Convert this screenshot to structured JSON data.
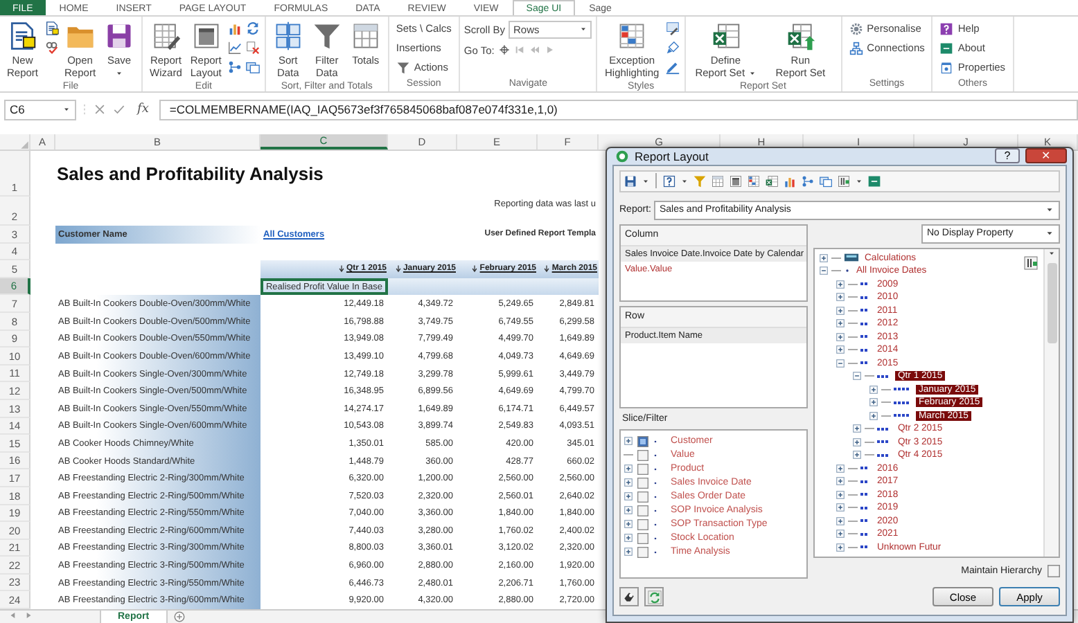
{
  "ribbon": {
    "tabs": [
      {
        "label": "FILE",
        "kind": "file",
        "selected": false
      },
      {
        "label": "HOME",
        "kind": "tab",
        "selected": false
      },
      {
        "label": "INSERT",
        "kind": "tab",
        "selected": false
      },
      {
        "label": "PAGE LAYOUT",
        "kind": "tab",
        "selected": false
      },
      {
        "label": "FORMULAS",
        "kind": "tab",
        "selected": false
      },
      {
        "label": "DATA",
        "kind": "tab",
        "selected": false
      },
      {
        "label": "REVIEW",
        "kind": "tab",
        "selected": false
      },
      {
        "label": "VIEW",
        "kind": "tab",
        "selected": false
      },
      {
        "label": "Sage UI",
        "kind": "tab",
        "selected": true
      },
      {
        "label": "Sage",
        "kind": "tab",
        "selected": false
      }
    ],
    "groups": [
      {
        "label": "File",
        "items": [
          {
            "kind": "large",
            "label": "New Report",
            "menu": false
          },
          {
            "kind": "large",
            "label": "Open Report",
            "menu": false
          },
          {
            "kind": "large",
            "label": "Save",
            "menu": true
          }
        ]
      },
      {
        "label": "Edit",
        "items": [
          {
            "kind": "large",
            "label": "Report Wizard",
            "menu": false
          },
          {
            "kind": "large",
            "label": "Report Layout",
            "menu": false
          }
        ]
      },
      {
        "label": "Sort, Filter and Totals",
        "items": [
          {
            "kind": "large",
            "label": "Sort Data",
            "menu": false
          },
          {
            "kind": "large",
            "label": "Filter Data",
            "menu": false
          },
          {
            "kind": "large",
            "label": "Totals",
            "menu": false
          }
        ]
      },
      {
        "label": "Session",
        "items": [
          {
            "kind": "small",
            "label": "Sets \\ Calcs"
          },
          {
            "kind": "small",
            "label": "Insertions"
          },
          {
            "kind": "small",
            "label": "Actions"
          }
        ]
      },
      {
        "label": "Navigate",
        "items": [
          {
            "kind": "select",
            "label": "Scroll By",
            "value": "Rows"
          },
          {
            "kind": "goto",
            "label": "Go To:"
          }
        ]
      },
      {
        "label": "Styles",
        "items": [
          {
            "kind": "large",
            "label": "Exception Highlighting",
            "menu": false
          }
        ]
      },
      {
        "label": "Report Set",
        "items": [
          {
            "kind": "large",
            "label": "Define Report Set",
            "menu": true
          },
          {
            "kind": "large",
            "label": "Run Report Set",
            "menu": false
          }
        ]
      },
      {
        "label": "Settings",
        "items": [
          {
            "kind": "small",
            "label": "Personalise"
          },
          {
            "kind": "small",
            "label": "Connections"
          }
        ]
      },
      {
        "label": "Others",
        "items": [
          {
            "kind": "small",
            "label": "Help"
          },
          {
            "kind": "small",
            "label": "About"
          },
          {
            "kind": "small",
            "label": "Properties"
          }
        ]
      }
    ]
  },
  "formula_bar": {
    "name_box": "C6",
    "function_label": "fx",
    "formula": "=COLMEMBERNAME(IAQ_IAQ5673ef3f765845068baf087e074f331e,1,0)"
  },
  "sheet": {
    "columns": [
      {
        "label": "A",
        "selected": false
      },
      {
        "label": "B",
        "selected": false
      },
      {
        "label": "C",
        "selected": true
      },
      {
        "label": "D",
        "selected": false
      },
      {
        "label": "E",
        "selected": false
      },
      {
        "label": "F",
        "selected": false
      },
      {
        "label": "G",
        "selected": false
      },
      {
        "label": "H",
        "selected": false
      },
      {
        "label": "I",
        "selected": false
      },
      {
        "label": "J",
        "selected": false
      },
      {
        "label": "K",
        "selected": false
      }
    ],
    "row_numbers": [
      {
        "label": "1",
        "selected": false
      },
      {
        "label": "2",
        "selected": false
      },
      {
        "label": "3",
        "selected": false
      },
      {
        "label": "4",
        "selected": false
      },
      {
        "label": "5",
        "selected": false
      },
      {
        "label": "6",
        "selected": true
      },
      {
        "label": "7",
        "selected": false
      },
      {
        "label": "8",
        "selected": false
      },
      {
        "label": "9",
        "selected": false
      },
      {
        "label": "10",
        "selected": false
      },
      {
        "label": "11",
        "selected": false
      },
      {
        "label": "12",
        "selected": false
      },
      {
        "label": "13",
        "selected": false
      },
      {
        "label": "14",
        "selected": false
      },
      {
        "label": "15",
        "selected": false
      },
      {
        "label": "16",
        "selected": false
      },
      {
        "label": "17",
        "selected": false
      },
      {
        "label": "18",
        "selected": false
      },
      {
        "label": "19",
        "selected": false
      },
      {
        "label": "20",
        "selected": false
      },
      {
        "label": "21",
        "selected": false
      },
      {
        "label": "22",
        "selected": false
      },
      {
        "label": "23",
        "selected": false
      },
      {
        "label": "24",
        "selected": false
      }
    ],
    "title": "Sales and Profitability Analysis",
    "notes": [
      "Reporting data was last u",
      "User Defined Report Templa"
    ],
    "filter": {
      "label": "Customer Name",
      "value": "All Customers"
    },
    "column_headers": [
      "Qtr 1 2015",
      "January 2015",
      "February 2015",
      "March 2015"
    ],
    "measure": {
      "label": "Realised Profit Value In Base",
      "selected": true
    },
    "data_rows": [
      {
        "label": "AB Built-In Cookers Double-Oven/300mm/White",
        "values": [
          "12,449.18",
          "4,349.72",
          "5,249.65",
          "2,849.81"
        ]
      },
      {
        "label": "AB Built-In Cookers Double-Oven/500mm/White",
        "values": [
          "16,798.88",
          "3,749.75",
          "6,749.55",
          "6,299.58"
        ]
      },
      {
        "label": "AB Built-In Cookers Double-Oven/550mm/White",
        "values": [
          "13,949.08",
          "7,799.49",
          "4,499.70",
          "1,649.89"
        ]
      },
      {
        "label": "AB Built-In Cookers Double-Oven/600mm/White",
        "values": [
          "13,499.10",
          "4,799.68",
          "4,049.73",
          "4,649.69"
        ]
      },
      {
        "label": "AB Built-In Cookers Single-Oven/300mm/White",
        "values": [
          "12,749.18",
          "3,299.78",
          "5,999.61",
          "3,449.79"
        ]
      },
      {
        "label": "AB Built-In Cookers Single-Oven/500mm/White",
        "values": [
          "16,348.95",
          "6,899.56",
          "4,649.69",
          "4,799.70"
        ]
      },
      {
        "label": "AB Built-In Cookers Single-Oven/550mm/White",
        "values": [
          "14,274.17",
          "1,649.89",
          "6,174.71",
          "6,449.57"
        ]
      },
      {
        "label": "AB Built-In Cookers Single-Oven/600mm/White",
        "values": [
          "10,543.08",
          "3,899.74",
          "2,549.83",
          "4,093.51"
        ]
      },
      {
        "label": "AB Cooker Hoods Chimney/White",
        "values": [
          "1,350.01",
          "585.00",
          "420.00",
          "345.01"
        ]
      },
      {
        "label": "AB Cooker Hoods Standard/White",
        "values": [
          "1,448.79",
          "360.00",
          "428.77",
          "660.02"
        ]
      },
      {
        "label": "AB Freestanding Electric 2-Ring/300mm/White",
        "values": [
          "6,320.00",
          "1,200.00",
          "2,560.00",
          "2,560.00"
        ]
      },
      {
        "label": "AB Freestanding Electric 2-Ring/500mm/White",
        "values": [
          "7,520.03",
          "2,320.00",
          "2,560.01",
          "2,640.02"
        ]
      },
      {
        "label": "AB Freestanding Electric 2-Ring/550mm/White",
        "values": [
          "7,040.00",
          "3,360.00",
          "1,840.00",
          "1,840.00"
        ]
      },
      {
        "label": "AB Freestanding Electric 2-Ring/600mm/White",
        "values": [
          "7,440.03",
          "3,280.00",
          "1,760.02",
          "2,400.02"
        ]
      },
      {
        "label": "AB Freestanding Electric 3-Ring/300mm/White",
        "values": [
          "8,800.03",
          "3,360.01",
          "3,120.02",
          "2,320.00"
        ]
      },
      {
        "label": "AB Freestanding Electric 3-Ring/500mm/White",
        "values": [
          "6,960.00",
          "2,880.00",
          "2,160.00",
          "1,920.00"
        ]
      },
      {
        "label": "AB Freestanding Electric 3-Ring/550mm/White",
        "values": [
          "6,446.73",
          "2,480.01",
          "2,206.71",
          "1,760.00"
        ]
      },
      {
        "label": "AB Freestanding Electric 3-Ring/600mm/White",
        "values": [
          "9,920.00",
          "4,320.00",
          "2,880.00",
          "2,720.00"
        ]
      }
    ]
  },
  "sheet_tabs": [
    {
      "label": "Report",
      "selected": true
    }
  ],
  "dialog": {
    "title": "Report Layout",
    "help_glyph": "?",
    "close_glyph": "✕",
    "report_label": "Report:",
    "report_value": "Sales and Profitability Analysis",
    "column_header": "Column",
    "column_items": [
      {
        "label": "Sales Invoice Date.Invoice Date by Calendar",
        "kind": "dimension",
        "selected": true
      },
      {
        "label": "Value.Value",
        "kind": "measure",
        "selected": false
      }
    ],
    "row_header": "Row",
    "row_items": [
      {
        "label": "Product.Item Name",
        "kind": "dimension",
        "selected": true
      }
    ],
    "slice_label": "Slice/Filter",
    "slice_filter": [
      {
        "label": "Customer",
        "checked": true,
        "expandable": true
      },
      {
        "label": "Value",
        "checked": false,
        "expandable": false
      },
      {
        "label": "Product",
        "checked": false,
        "expandable": true
      },
      {
        "label": "Sales Invoice Date",
        "checked": false,
        "expandable": true
      },
      {
        "label": "Sales Order Date",
        "checked": false,
        "expandable": true
      },
      {
        "label": "SOP Invoice Analysis",
        "checked": false,
        "expandable": true
      },
      {
        "label": "SOP Transaction Type",
        "checked": false,
        "expandable": true
      },
      {
        "label": "Stock Location",
        "checked": false,
        "expandable": true
      },
      {
        "label": "Time Analysis",
        "checked": false,
        "expandable": true
      }
    ],
    "display_property": "No Display Property",
    "tree": [
      {
        "label": "Calculations",
        "kind": "calculation",
        "expanded": false,
        "selected": false
      },
      {
        "label": "All Invoice Dates",
        "kind": "hierarchy",
        "expanded": true,
        "selected": false,
        "children": [
          {
            "label": "2009",
            "expanded": false,
            "selected": false
          },
          {
            "label": "2010",
            "expanded": false,
            "selected": false
          },
          {
            "label": "2011",
            "expanded": false,
            "selected": false
          },
          {
            "label": "2012",
            "expanded": false,
            "selected": false
          },
          {
            "label": "2013",
            "expanded": false,
            "selected": false
          },
          {
            "label": "2014",
            "expanded": false,
            "selected": false
          },
          {
            "label": "2015",
            "expanded": true,
            "selected": false,
            "children": [
              {
                "label": "Qtr 1 2015",
                "expanded": true,
                "selected": true,
                "children": [
                  {
                    "label": "January 2015",
                    "expanded": false,
                    "selected": true
                  },
                  {
                    "label": "February 2015",
                    "expanded": false,
                    "selected": true
                  },
                  {
                    "label": "March 2015",
                    "expanded": false,
                    "selected": true
                  }
                ]
              },
              {
                "label": "Qtr 2 2015",
                "expanded": false,
                "selected": false
              },
              {
                "label": "Qtr 3 2015",
                "expanded": false,
                "selected": false
              },
              {
                "label": "Qtr 4 2015",
                "expanded": false,
                "selected": false
              }
            ]
          },
          {
            "label": "2016",
            "expanded": false,
            "selected": false
          },
          {
            "label": "2017",
            "expanded": false,
            "selected": false
          },
          {
            "label": "2018",
            "expanded": false,
            "selected": false
          },
          {
            "label": "2019",
            "expanded": false,
            "selected": false
          },
          {
            "label": "2020",
            "expanded": false,
            "selected": false
          },
          {
            "label": "2021",
            "expanded": false,
            "selected": false
          },
          {
            "label": "Unknown Futur",
            "expanded": false,
            "selected": false
          }
        ]
      }
    ],
    "maintain_hierarchy": {
      "label": "Maintain Hierarchy",
      "checked": false
    },
    "buttons": [
      "Close",
      "Apply"
    ]
  }
}
